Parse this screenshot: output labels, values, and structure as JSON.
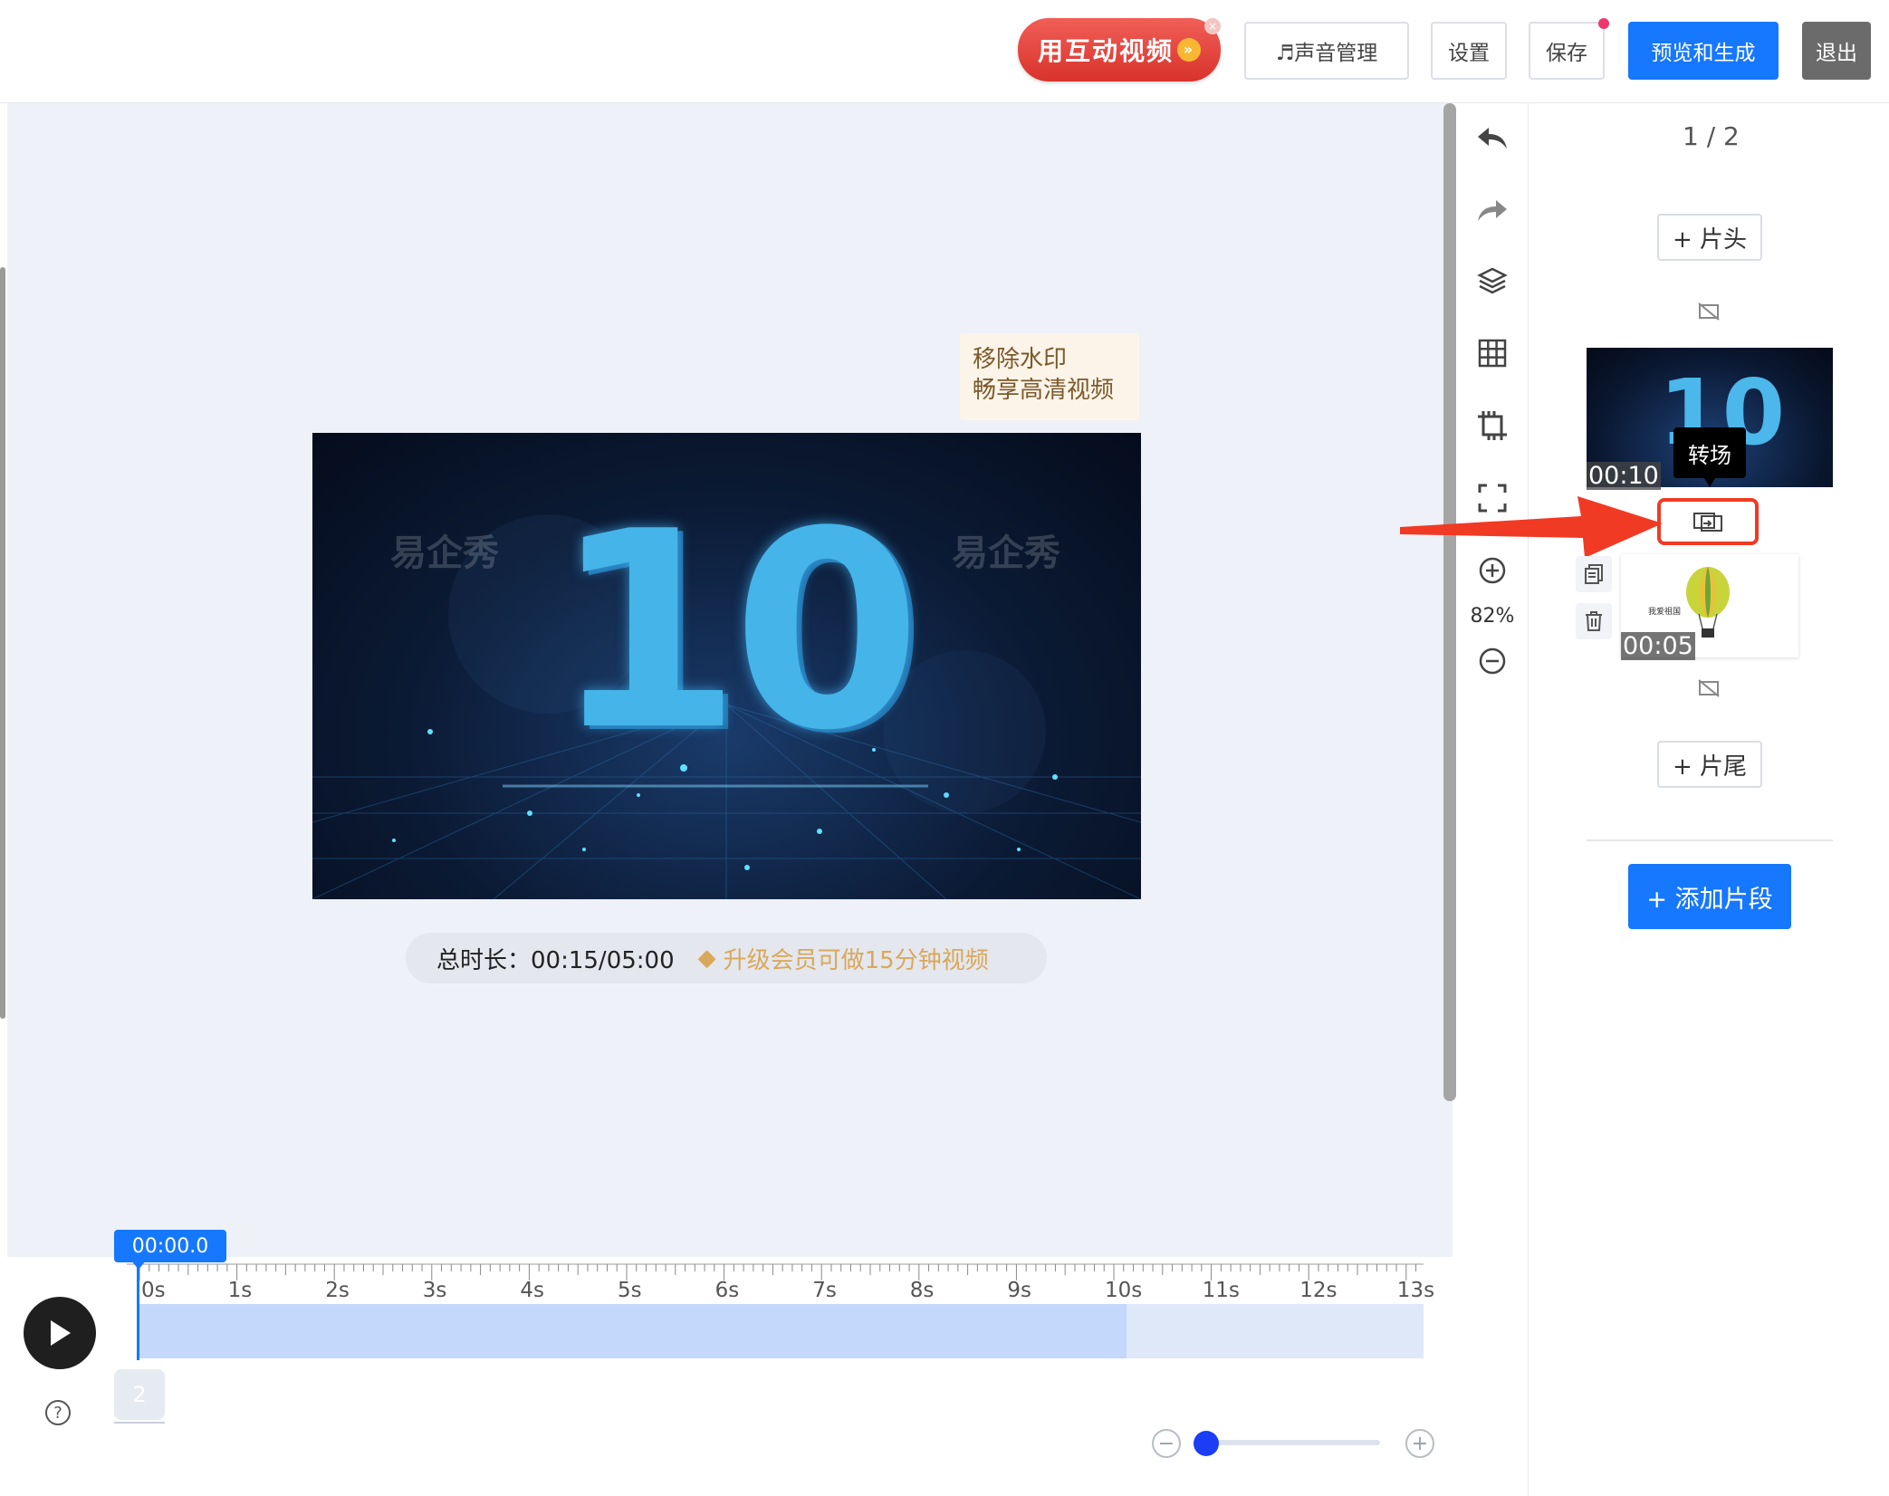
{
  "header": {
    "promo_label": "用互动视频",
    "promo_close": "×",
    "sound_label": "♬声音管理",
    "settings_label": "设置",
    "save_label": "保存",
    "preview_label": "预览和生成",
    "exit_label": "退出"
  },
  "canvas": {
    "watermark_line1": "移除水印",
    "watermark_line2": "畅享高清视频",
    "video_watermark": "易企秀",
    "video_number": "10",
    "duration_label": "总时长：00:15/05:00",
    "upgrade_text": "升级会员可做15分钟视频"
  },
  "tools": {
    "zoom_level": "82%"
  },
  "right_panel": {
    "page_indicator": "1 / 2",
    "add_head_label": "+ 片头",
    "add_tail_label": "+ 片尾",
    "clip1_time": "00:10",
    "clip1_number": "10",
    "clip2_time": "00:05",
    "clip2_caption": "我爱祖国",
    "transition_tooltip": "转场",
    "add_segment_label": "+ 添加片段"
  },
  "timeline": {
    "playhead_time": "00:00.0",
    "ruler_labels": [
      "0s",
      "1s",
      "2s",
      "3s",
      "4s",
      "5s",
      "6s",
      "7s",
      "8s",
      "9s",
      "10s",
      "11s",
      "12s",
      "13s"
    ],
    "layer_number": "2",
    "help": "?",
    "zoom_minus": "−",
    "zoom_plus": "+"
  },
  "colors": {
    "primary": "#1677ff",
    "highlight_red": "#f03a24",
    "gold": "#d9a85a"
  }
}
